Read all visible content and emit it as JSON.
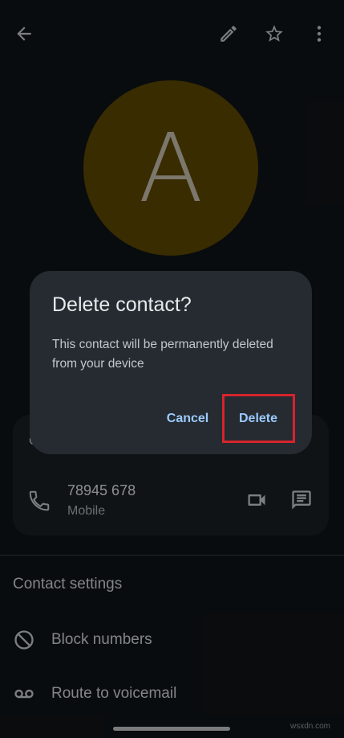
{
  "colors": {
    "background": "#101417",
    "avatar_fill": "#5c4700",
    "avatar_letter": "#c8c1ae",
    "accent": "#9ccaff",
    "highlight": "#d7232e"
  },
  "topbar": {
    "back_icon": "arrow-back-icon",
    "edit_icon": "pencil-icon",
    "star_icon": "star-outline-icon",
    "more_icon": "more-vertical-icon"
  },
  "avatar": {
    "letter": "A"
  },
  "card": {
    "header": "C",
    "phone_number": "78945 678",
    "phone_type": "Mobile",
    "phone_icon": "phone-icon",
    "video_icon": "video-call-icon",
    "message_icon": "message-icon"
  },
  "settings": {
    "title": "Contact settings",
    "items": [
      {
        "label": "Block numbers",
        "icon": "block-icon"
      },
      {
        "label": "Route to voicemail",
        "icon": "voicemail-icon"
      }
    ]
  },
  "dialog": {
    "title": "Delete contact?",
    "body": "This contact will be permanently deleted from your device",
    "cancel_label": "Cancel",
    "delete_label": "Delete"
  },
  "watermark": "wsxdn.com"
}
